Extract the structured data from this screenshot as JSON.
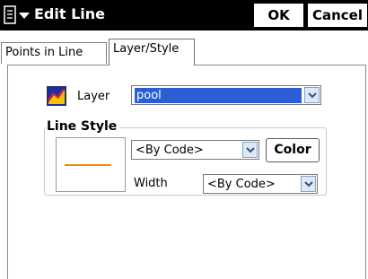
{
  "window": {
    "title": "Edit Line",
    "title_bg": "#000000"
  },
  "toolbar": {
    "ok_label": "OK",
    "cancel_label": "Cancel",
    "menu_icon": "start-menu-icon"
  },
  "tabs": [
    {
      "label": "Points in Line",
      "active": false
    },
    {
      "label": "Layer/Style",
      "active": true
    }
  ],
  "layer": {
    "label": "Layer",
    "value": "pool",
    "icon": "layer-icon",
    "highlight_color": "#2a5fd3"
  },
  "line_style": {
    "group_title": "Line Style",
    "style_value": "<By Code>",
    "color_button": "Color",
    "width_label": "Width",
    "width_value": "<By Code>",
    "preview_line_color": "#f08a10"
  }
}
